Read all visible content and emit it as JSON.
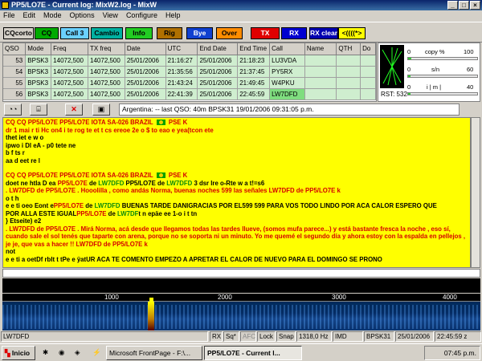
{
  "window": {
    "title": "PP5/LO7E - Current log: MixW2.log - MixW"
  },
  "menu": [
    "File",
    "Edit",
    "Mode",
    "Options",
    "View",
    "Configure",
    "Help"
  ],
  "macros": [
    {
      "label": "CQcorto",
      "bg": "#d4d0c8",
      "fg": "#000000"
    },
    {
      "label": "CQ",
      "bg": "#00aa00",
      "fg": "#000000"
    },
    {
      "label": "Call 3",
      "bg": "#6ad0ff",
      "fg": "#000000"
    },
    {
      "label": "Cambio",
      "bg": "#00b0a0",
      "fg": "#000000"
    },
    {
      "label": "Info",
      "bg": "#22cc22",
      "fg": "#000000"
    },
    {
      "label": "Rig",
      "bg": "#b07000",
      "fg": "#000000"
    },
    {
      "label": "Bye",
      "bg": "#1040d0",
      "fg": "#ffffff"
    },
    {
      "label": "Over",
      "bg": "#ff8c00",
      "fg": "#000000"
    },
    {
      "label": "TX",
      "bg": "#e00000",
      "fg": "#ffffff"
    },
    {
      "label": "RX",
      "bg": "#0000d0",
      "fg": "#ffffff"
    },
    {
      "label": "RX clear",
      "bg": "#0000b0",
      "fg": "#ffffff"
    },
    {
      "label": "<((((*>",
      "bg": "#ffff00",
      "fg": "#000000"
    }
  ],
  "log": {
    "columns": [
      "QSO",
      "Mode",
      "Freq",
      "TX freq",
      "Date",
      "UTC",
      "End Date",
      "End Time",
      "Call",
      "Name",
      "QTH",
      "Do"
    ],
    "rows": [
      [
        "53",
        "BPSK3",
        "14072,500",
        "14072,500",
        "25/01/2006",
        "21:16:27",
        "25/01/2006",
        "21:18:23",
        "LU3VDA",
        "",
        "",
        ""
      ],
      [
        "54",
        "BPSK3",
        "14072,500",
        "14072,500",
        "25/01/2006",
        "21:35:56",
        "25/01/2006",
        "21:37:45",
        "PY5RX",
        "",
        "",
        ""
      ],
      [
        "55",
        "BPSK3",
        "14072,500",
        "14072,500",
        "25/01/2006",
        "21:43:24",
        "25/01/2006",
        "21:49:45",
        "W4PKU",
        "",
        "",
        ""
      ],
      [
        "56",
        "BPSK3",
        "14072,500",
        "14072,500",
        "25/01/2006",
        "22:41:39",
        "25/01/2006",
        "22:45:59",
        "LW7DFD",
        "",
        "",
        ""
      ]
    ]
  },
  "meters": {
    "rst": "RST: 532",
    "copy": {
      "min": "0",
      "label": "copy %",
      "max": "100",
      "level": 0.05
    },
    "sn": {
      "min": "0",
      "label": "s/n",
      "max": "60",
      "level": 0.04
    },
    "imd": {
      "min": "0",
      "label": "i | m |",
      "max": "40",
      "level": 0.03
    }
  },
  "lastqso": "Argentina:  -- last QSO: 40m BPSK31 19/01/2006 09:31:05 p.m.",
  "rx": {
    "l1a": "CQ CQ PP5/LO7E PP5/LO7E  IOTA SA-026 BRAZIL ",
    "l1b": "  PSE K",
    "l2": "dr  1 mai r ti Hc on4  i te  rog te et  t  cs ereoe 2e    o  $  to eao e  yea(tcon  ete",
    "l3": "thet iet    e  w o",
    "l4": "  ipwo i Dl eA - p0 tete ne",
    "l5": "b f ts r",
    "l6": "aa  d  eet re  l",
    "l7a": "CQ CQ PP5/LO7E PP5/LO7E  IOTA SA-026 BRAZIL ",
    "l7b": "  PSE K",
    "l8a": "doet    ne htla  D ea  ",
    "l8b": "PP5/LO7E",
    "l8c": " de ",
    "l8d": "LW7DFD",
    "l8e": "  PP5/LO7E de ",
    "l8f": "LW7DFD",
    "l8g": " 3 dsr lre  o-Rte w a t!=s6",
    "l9a": ". LW7DFD de PP5/LO7E .   Hooolilla , como andás Norma, buenas noches 599 las señales LW7DFD de PP5/LO7E k",
    "l10": "  o  t  h",
    "l11a": "e e ti oeo Eont e",
    "l11b": "PP5/LO7E",
    "l11c": " de ",
    "l11d": "LW7DFD",
    "l11e": " BUENAS TARDE DANIGRACIAS POR EL599 599 PARA VOS TODO LINDO POR ACA CALOR ESPERO QUE",
    "l12a": "POR ALLA ESTE IGUAL",
    "l12b": "PP5/LO7E",
    "l12c": " de ",
    "l12d": "LW7DF",
    "l12e": "t n epäe ee  1-o i t tn",
    "l13": "} Etseite) e2",
    "l14": ". LW7DFD de PP5/LO7E .   Mirá Norma, acá desde que llegamos todas las tardes llueve, (somos mufa parece...) y está bastante fresca la noche , eso sí, cuando sale el sol tenés que taparte con arena, porque no se soporta ni un minuto. Yo me quemé el segundo día y ahora estoy con la espalda en pellejos , je je, que vas a hacer !!   LW7DFD de PP5/LO7E k",
    "l15": "not",
    "l16": "e e ti a oetDf rblt t tPe e ÿatUR ACA TE COMENTO EMPEZO A APRETAR EL CALOR DE NUEVO PARA EL DOMINGO SE PRONO"
  },
  "waterfall": {
    "ticks": [
      "1000",
      "2000",
      "3000",
      "4000"
    ]
  },
  "status": {
    "call": "LW7DFD",
    "rx": "RX",
    "sq": "Sq*",
    "afc": "AFC",
    "lock": "Lock",
    "snap": "Snap",
    "freq": "1318,0 Hz",
    "imd": "IMD",
    "mode": "BPSK31",
    "date": "25/01/2006",
    "time": "22:45:59 z"
  },
  "taskbar": {
    "start": "Inicio",
    "task1": "Microsoft FrontPage - F:\\...",
    "task2": "PP5/LO7E - Current l...",
    "clock": "07:45 p.m."
  }
}
